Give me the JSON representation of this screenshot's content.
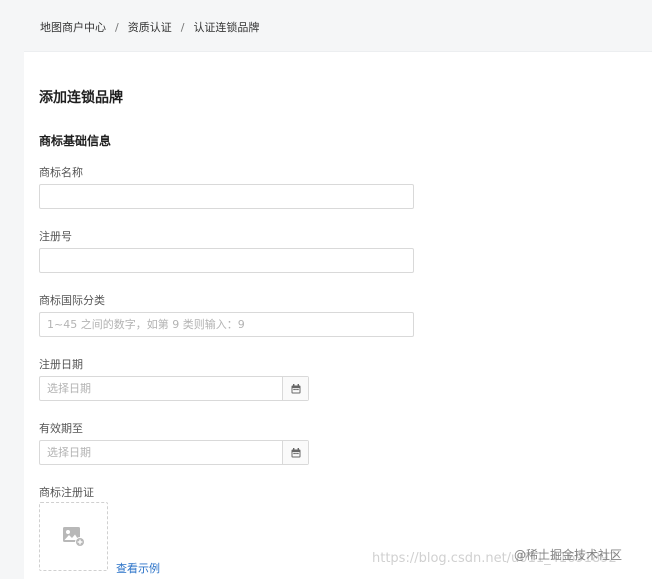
{
  "breadcrumb": {
    "items": [
      "地图商户中心",
      "资质认证",
      "认证连锁品牌"
    ],
    "separator": "/"
  },
  "page": {
    "title": "添加连锁品牌",
    "section_title": "商标基础信息"
  },
  "form": {
    "trademark_name": {
      "label": "商标名称",
      "value": "",
      "placeholder": ""
    },
    "registration_number": {
      "label": "注册号",
      "value": "",
      "placeholder": ""
    },
    "intl_class": {
      "label": "商标国际分类",
      "value": "",
      "placeholder": "1~45 之间的数字，如第 9 类则输入：9"
    },
    "registration_date": {
      "label": "注册日期",
      "value": "",
      "placeholder": "选择日期"
    },
    "valid_until": {
      "label": "有效期至",
      "value": "",
      "placeholder": "选择日期"
    },
    "certificate": {
      "label": "商标注册证",
      "sample_link": "查看示例"
    }
  },
  "watermark": {
    "url": "https://blog.csdn.net/u011_41691892",
    "brand": "@稀土掘金技术社区"
  },
  "colors": {
    "link": "#2a72c8",
    "border": "#d9d9d9",
    "header_bg": "#f5f6f7"
  },
  "icons": {
    "calendar": "calendar-icon",
    "image_placeholder": "image-add-icon"
  }
}
